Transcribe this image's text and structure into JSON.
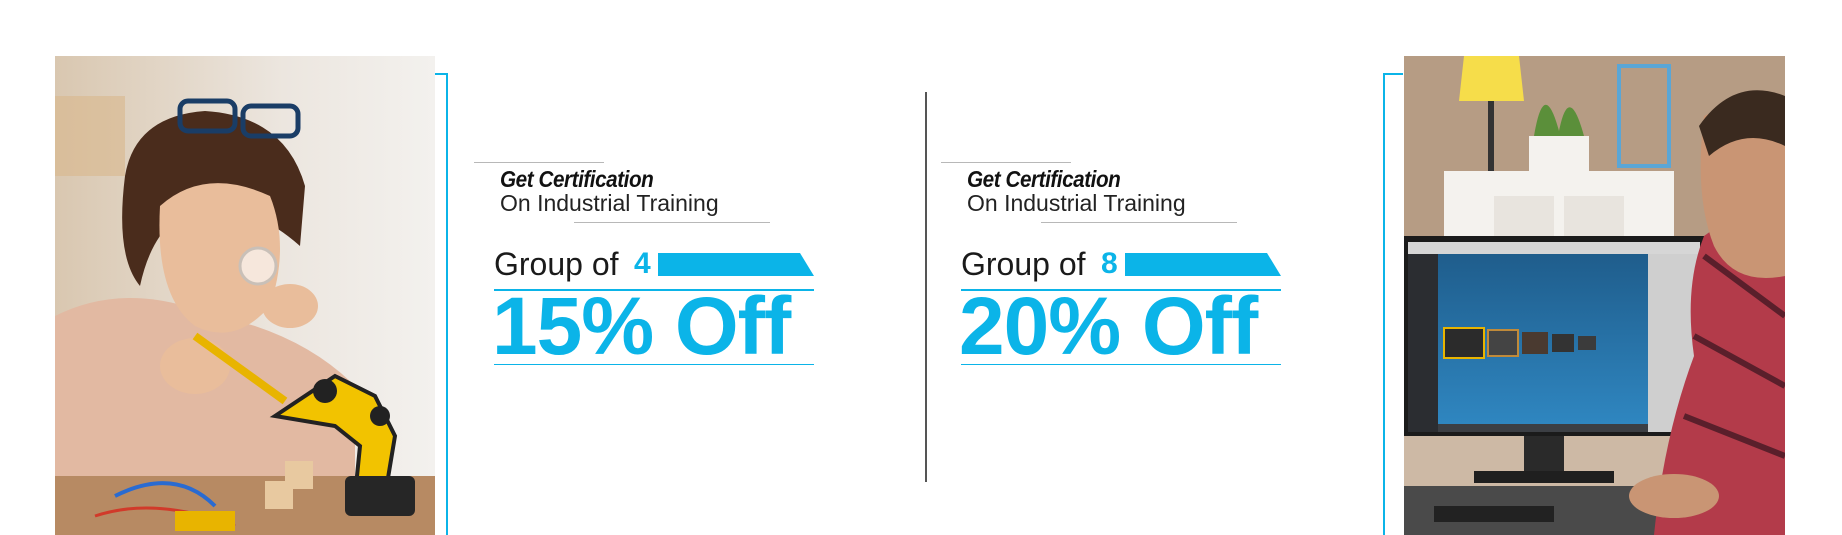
{
  "offers": [
    {
      "tagline": "Get Certification",
      "subline": "On Industrial Training",
      "group_label": "Group of",
      "group_size": "4",
      "discount": "15% Off"
    },
    {
      "tagline": "Get Certification",
      "subline": "On Industrial Training",
      "group_label": "Group of",
      "group_size": "8",
      "discount": "20% Off"
    }
  ],
  "colors": {
    "accent": "#0bb4e8",
    "text": "#1a1a1a",
    "divider": "#555555"
  },
  "images": {
    "left": "woman-assembling-robotic-arm-photo",
    "right": "man-at-3d-modeling-monitor-photo"
  }
}
